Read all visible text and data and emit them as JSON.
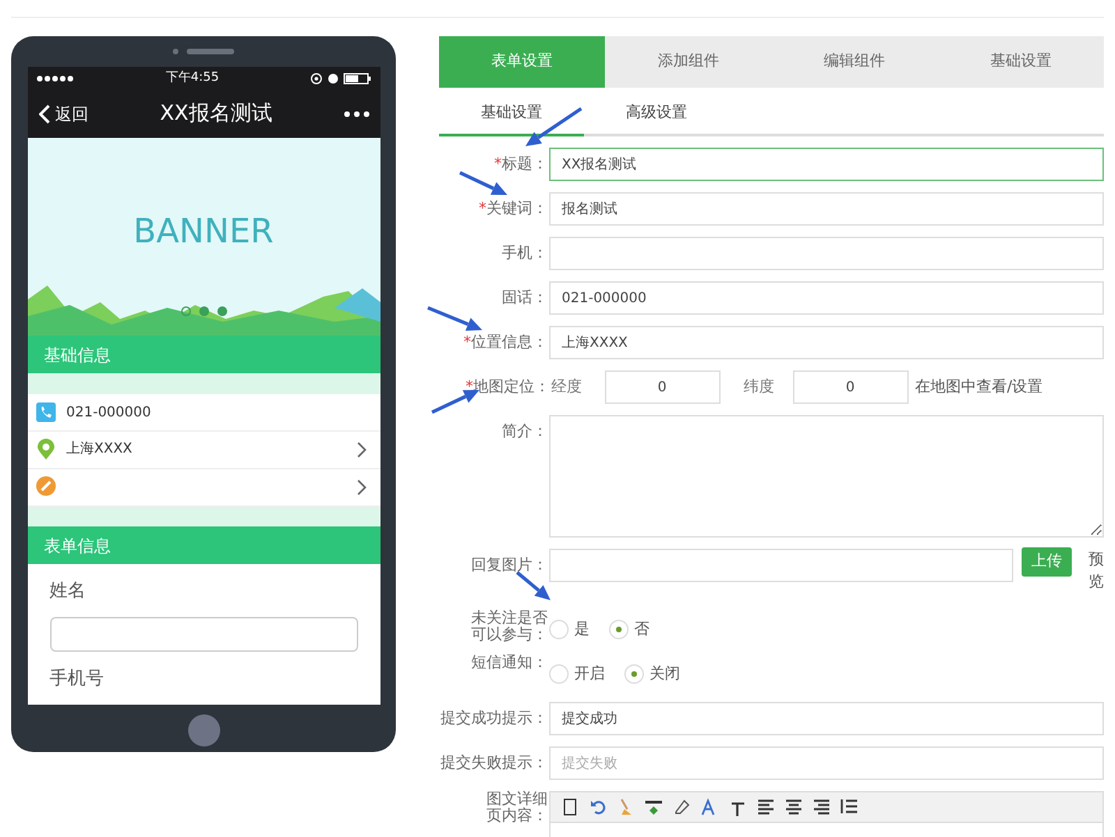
{
  "phone": {
    "status": {
      "time": "下午4:55"
    },
    "nav": {
      "back": "返回",
      "title": "XX报名测试"
    },
    "banner": {
      "text": "BANNER",
      "dots": [
        {
          "selected": true
        },
        {
          "selected": false
        },
        {
          "selected": false
        }
      ]
    },
    "basic_section": {
      "title": "基础信息",
      "rows": [
        {
          "kind": "phone",
          "text": "021-000000",
          "chevron": false
        },
        {
          "kind": "location",
          "text": "上海XXXX",
          "chevron": true
        },
        {
          "kind": "edit",
          "text": "",
          "chevron": true
        }
      ]
    },
    "form_section": {
      "title": "表单信息",
      "fields": [
        {
          "label": "姓名",
          "input": true
        },
        {
          "label": "手机号",
          "input": false
        }
      ]
    }
  },
  "tabs": [
    {
      "label": "表单设置",
      "selected": true
    },
    {
      "label": "添加组件",
      "selected": false
    },
    {
      "label": "编辑组件",
      "selected": false
    },
    {
      "label": "基础设置",
      "selected": false
    }
  ],
  "subtabs": [
    {
      "label": "基础设置",
      "selected": true
    },
    {
      "label": "高级设置",
      "selected": false
    }
  ],
  "rows": [
    {
      "kind": "input",
      "required_mark": "*",
      "label": "标题：",
      "value": "XX报名测试",
      "focused": true
    },
    {
      "kind": "input",
      "required_mark": "*",
      "label": "关键词：",
      "value": "报名测试",
      "focused": false
    },
    {
      "kind": "input",
      "label": "手机：",
      "value": "",
      "focused": false
    },
    {
      "kind": "input",
      "label": "固话：",
      "value": "021-000000",
      "focused": false
    },
    {
      "kind": "input",
      "required_mark": "*",
      "label": "位置信息：",
      "value": "上海XXXX",
      "focused": false
    },
    {
      "kind": "map",
      "required_mark": "*",
      "label": "地图定位：",
      "lng_label": "经度",
      "lng": "0",
      "lat_label": "纬度",
      "lat": "0",
      "link": "在地图中查看/设置"
    },
    {
      "kind": "textarea",
      "label": "简介：",
      "value": ""
    },
    {
      "kind": "upload",
      "label": "回复图片：",
      "button": "上传",
      "preview": "预览"
    },
    {
      "kind": "radio",
      "label": "未关注是否可以参与：",
      "options": [
        {
          "label": "是",
          "selected": false
        },
        {
          "label": "否",
          "selected": true
        }
      ]
    },
    {
      "kind": "radio",
      "label": "短信通知：",
      "options": [
        {
          "label": "开启",
          "selected": false
        },
        {
          "label": "关闭",
          "selected": true
        }
      ]
    },
    {
      "kind": "input",
      "label": "提交成功提示：",
      "value": "提交成功",
      "focused": false
    },
    {
      "kind": "input",
      "label": "提交失败提示：",
      "placeholder": "提交失败",
      "focused": false
    },
    {
      "kind": "editor",
      "label": "图文详细页内容："
    }
  ]
}
